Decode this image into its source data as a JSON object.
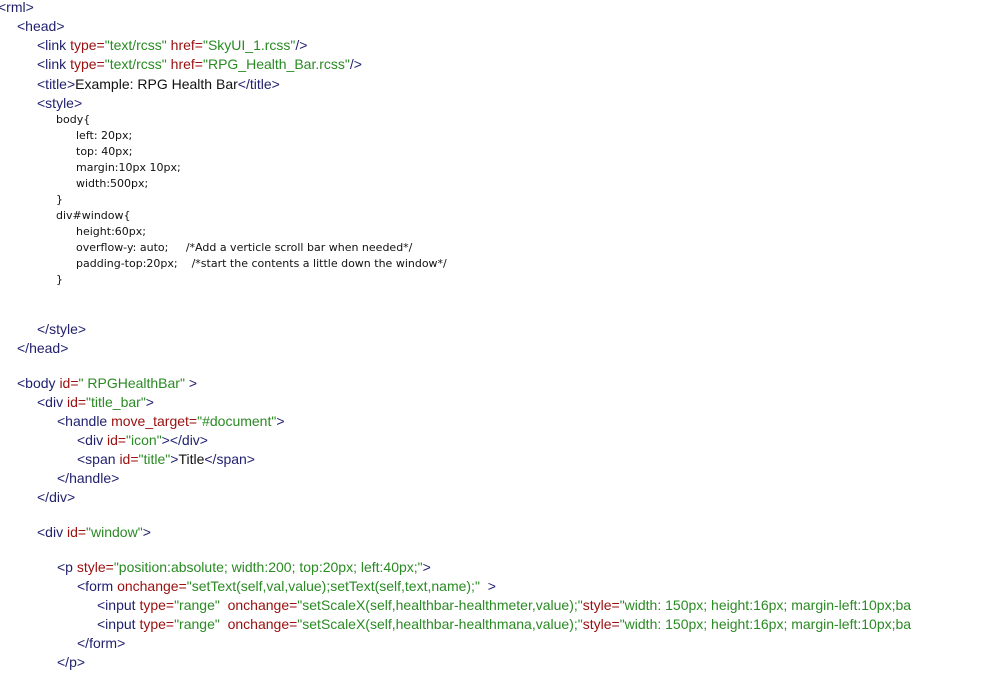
{
  "source": {
    "lines": [
      [
        {
          "t": "tg",
          "s": "<rml>"
        }
      ],
      [
        {
          "t": "tg",
          "s": "<head>"
        }
      ],
      [
        {
          "t": "tg",
          "s": "<link "
        },
        {
          "t": "at",
          "s": "type="
        },
        {
          "t": "vl",
          "s": "\"text/rcss\""
        },
        {
          "t": "at",
          "s": " href="
        },
        {
          "t": "vl",
          "s": "\"SkyUI_1.rcss\""
        },
        {
          "t": "tg",
          "s": "/>"
        }
      ],
      [
        {
          "t": "tg",
          "s": "<link "
        },
        {
          "t": "at",
          "s": "type="
        },
        {
          "t": "vl",
          "s": "\"text/rcss\""
        },
        {
          "t": "at",
          "s": " href="
        },
        {
          "t": "vl",
          "s": "\"RPG_Health_Bar.rcss\""
        },
        {
          "t": "tg",
          "s": "/>"
        }
      ],
      [
        {
          "t": "tg",
          "s": "<title>"
        },
        {
          "t": "tx",
          "s": "Example: RPG Health Bar"
        },
        {
          "t": "tg",
          "s": "</title>"
        }
      ],
      [
        {
          "t": "tg",
          "s": "<style>"
        }
      ],
      [
        {
          "t": "tx",
          "s": "body{"
        }
      ],
      [
        {
          "t": "tx",
          "s": "left: 20px;"
        }
      ],
      [
        {
          "t": "tx",
          "s": "top: 40px;"
        }
      ],
      [
        {
          "t": "tx",
          "s": "margin:10px 10px;"
        }
      ],
      [
        {
          "t": "tx",
          "s": "width:500px;"
        }
      ],
      [
        {
          "t": "tx",
          "s": "}"
        }
      ],
      [
        {
          "t": "tx",
          "s": "div#window{"
        }
      ],
      [
        {
          "t": "tx",
          "s": "height:60px;"
        }
      ],
      [
        {
          "t": "tx",
          "s": "overflow-y: auto;     /*Add a verticle scroll bar when needed*/"
        }
      ],
      [
        {
          "t": "tx",
          "s": "padding-top:20px;    /*start the contents a little down the window*/"
        }
      ],
      [
        {
          "t": "tx",
          "s": "}"
        }
      ],
      [
        {
          "t": "tg",
          "s": "</style>"
        }
      ],
      [
        {
          "t": "tg",
          "s": "</head>"
        }
      ],
      [
        {
          "t": "tg",
          "s": "<body "
        },
        {
          "t": "at",
          "s": "id="
        },
        {
          "t": "vl",
          "s": "\" RPGHealthBar\""
        },
        {
          "t": "tg",
          "s": " >"
        }
      ],
      [
        {
          "t": "tg",
          "s": "<div "
        },
        {
          "t": "at",
          "s": "id="
        },
        {
          "t": "vl",
          "s": "\"title_bar\""
        },
        {
          "t": "tg",
          "s": ">"
        }
      ],
      [
        {
          "t": "tg",
          "s": "<handle "
        },
        {
          "t": "at",
          "s": "move_target="
        },
        {
          "t": "vl",
          "s": "\"#document\""
        },
        {
          "t": "tg",
          "s": ">"
        }
      ],
      [
        {
          "t": "tg",
          "s": "<div "
        },
        {
          "t": "at",
          "s": "id="
        },
        {
          "t": "vl",
          "s": "\"icon\""
        },
        {
          "t": "tg",
          "s": "></div>"
        }
      ],
      [
        {
          "t": "tg",
          "s": "<span "
        },
        {
          "t": "at",
          "s": "id="
        },
        {
          "t": "vl",
          "s": "\"title\""
        },
        {
          "t": "tg",
          "s": ">"
        },
        {
          "t": "tx",
          "s": "Title"
        },
        {
          "t": "tg",
          "s": "</span>"
        }
      ],
      [
        {
          "t": "tg",
          "s": "</handle>"
        }
      ],
      [
        {
          "t": "tg",
          "s": "</div>"
        }
      ],
      [
        {
          "t": "tg",
          "s": "<div "
        },
        {
          "t": "at",
          "s": "id="
        },
        {
          "t": "vl",
          "s": "\"window\""
        },
        {
          "t": "tg",
          "s": ">"
        }
      ],
      [
        {
          "t": "tg",
          "s": "<p "
        },
        {
          "t": "at",
          "s": "style="
        },
        {
          "t": "vl",
          "s": "\"position:absolute; width:200; top:20px; left:40px;\""
        },
        {
          "t": "tg",
          "s": ">"
        }
      ],
      [
        {
          "t": "tg",
          "s": "<form "
        },
        {
          "t": "at",
          "s": "onchange="
        },
        {
          "t": "vl",
          "s": "\"setText(self,val,value);setText(self,text,name);\""
        },
        {
          "t": "tg",
          "s": "  >"
        }
      ],
      [
        {
          "t": "tg",
          "s": "<input "
        },
        {
          "t": "at",
          "s": "type="
        },
        {
          "t": "vl",
          "s": "\"range\""
        },
        {
          "t": "at",
          "s": "  onchange="
        },
        {
          "t": "vl",
          "s": "\"setScaleX(self,healthbar-healthmeter,value);\""
        },
        {
          "t": "at",
          "s": "style="
        },
        {
          "t": "vl",
          "s": "\"width: 150px; height:16px; margin-left:10px;ba"
        }
      ],
      [
        {
          "t": "tg",
          "s": "<input "
        },
        {
          "t": "at",
          "s": "type="
        },
        {
          "t": "vl",
          "s": "\"range\""
        },
        {
          "t": "at",
          "s": "  onchange="
        },
        {
          "t": "vl",
          "s": "\"setScaleX(self,healthbar-healthmana,value);\""
        },
        {
          "t": "at",
          "s": "style="
        },
        {
          "t": "vl",
          "s": "\"width: 150px; height:16px; margin-left:10px;ba"
        }
      ],
      [
        {
          "t": "tg",
          "s": "</form>"
        }
      ],
      [
        {
          "t": "tg",
          "s": "</p>"
        }
      ]
    ]
  }
}
